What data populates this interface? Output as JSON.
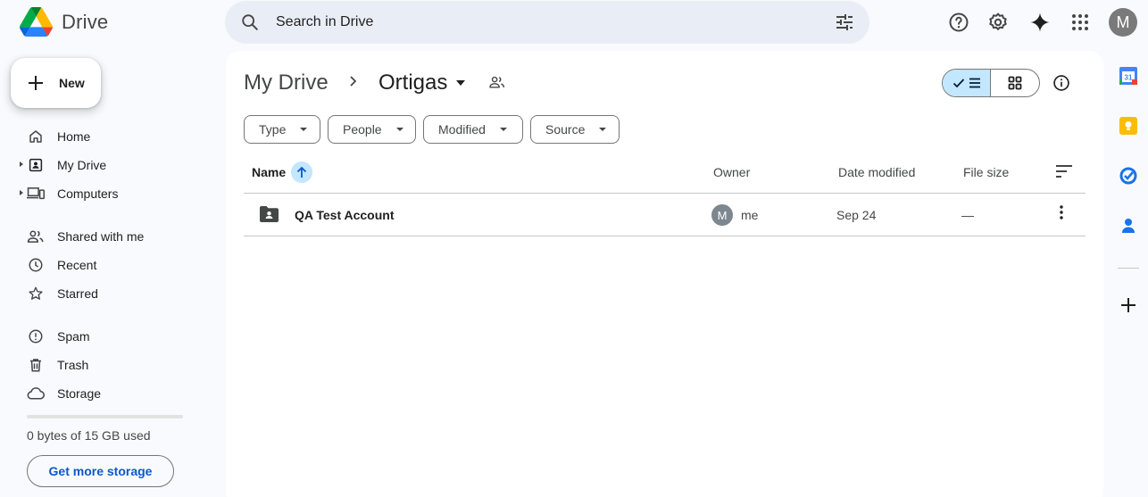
{
  "app": {
    "name": "Drive"
  },
  "search": {
    "placeholder": "Search in Drive"
  },
  "user": {
    "initial": "M"
  },
  "new_button": {
    "label": "New"
  },
  "sidebar": {
    "items": [
      {
        "label": "Home",
        "icon": "home-icon"
      },
      {
        "label": "My Drive",
        "icon": "my-drive-icon"
      },
      {
        "label": "Computers",
        "icon": "computers-icon"
      },
      {
        "label": "Shared with me",
        "icon": "shared-icon"
      },
      {
        "label": "Recent",
        "icon": "clock-icon"
      },
      {
        "label": "Starred",
        "icon": "star-icon"
      },
      {
        "label": "Spam",
        "icon": "spam-icon"
      },
      {
        "label": "Trash",
        "icon": "trash-icon"
      },
      {
        "label": "Storage",
        "icon": "cloud-icon"
      }
    ],
    "storage_used_fraction": 0,
    "storage_text": "0 bytes of 15 GB used",
    "storage_button": "Get more storage"
  },
  "breadcrumb": {
    "root": "My Drive",
    "current": "Ortigas"
  },
  "filters": [
    "Type",
    "People",
    "Modified",
    "Source"
  ],
  "table": {
    "headers": {
      "name": "Name",
      "owner": "Owner",
      "modified": "Date modified",
      "size": "File size"
    },
    "rows": [
      {
        "name": "QA Test Account",
        "owner_initial": "M",
        "owner": "me",
        "modified": "Sep 24",
        "size": "—"
      }
    ]
  },
  "colors": {
    "accent": "#0b57d0",
    "selected": "#c2e7ff",
    "surface": "#f8fafd",
    "search_bg": "#e9eef6"
  }
}
